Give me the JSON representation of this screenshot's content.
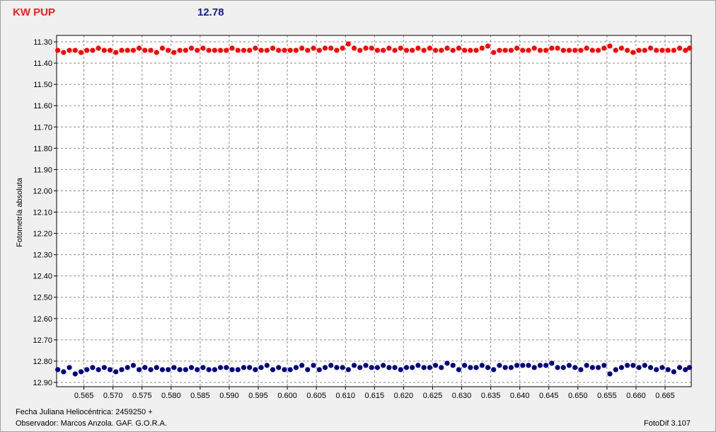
{
  "header": {
    "star_name": "KW PUP",
    "magnitude": "12.78"
  },
  "footer": {
    "fecha": "Fecha Juliana Heliocéntrica: 2459250 +",
    "observador": "Observador:  Marcos Anzola. GAF. G.O.R.A.",
    "software": "FotoDif 3.107"
  },
  "chart_data": {
    "type": "scatter",
    "ylabel": "Fotometría absoluta",
    "xlabel": "Fecha Juliana Heliocéntrica: 2459250 +",
    "xlim": [
      0.5603,
      0.6695
    ],
    "ylim": [
      12.92,
      11.27
    ],
    "y_inverted": true,
    "grid": true,
    "x_ticks": [
      "0.565",
      "0.570",
      "0.575",
      "0.580",
      "0.585",
      "0.590",
      "0.595",
      "0.600",
      "0.605",
      "0.610",
      "0.615",
      "0.620",
      "0.625",
      "0.630",
      "0.635",
      "0.640",
      "0.645",
      "0.650",
      "0.655",
      "0.660",
      "0.665"
    ],
    "y_ticks": [
      "11.30",
      "11.40",
      "11.50",
      "11.60",
      "11.70",
      "11.80",
      "11.90",
      "12.00",
      "12.10",
      "12.20",
      "12.30",
      "12.40",
      "12.50",
      "12.60",
      "12.70",
      "12.80",
      "12.90"
    ],
    "colors": {
      "series_top": "#ff0000",
      "series_bottom": "#000080"
    },
    "series": [
      {
        "x": [
          0.5605,
          0.5615,
          0.5625,
          0.5635,
          0.5645,
          0.5655,
          0.5665,
          0.5675,
          0.5685,
          0.5695,
          0.5705,
          0.5715,
          0.5725,
          0.5735,
          0.5745,
          0.5755,
          0.5765,
          0.5775,
          0.5785,
          0.5795,
          0.5805,
          0.5815,
          0.5825,
          0.5835,
          0.5845,
          0.5855,
          0.5865,
          0.5875,
          0.5885,
          0.5895,
          0.5905,
          0.5915,
          0.5925,
          0.5935,
          0.5945,
          0.5955,
          0.5965,
          0.5975,
          0.5985,
          0.5995,
          0.6005,
          0.6015,
          0.6025,
          0.6035,
          0.6045,
          0.6055,
          0.6065,
          0.6075,
          0.6085,
          0.6095,
          0.6105,
          0.6115,
          0.6125,
          0.6135,
          0.6145,
          0.6155,
          0.6165,
          0.6175,
          0.6185,
          0.6195,
          0.6205,
          0.6215,
          0.6225,
          0.6235,
          0.6245,
          0.6255,
          0.6265,
          0.6275,
          0.6285,
          0.6295,
          0.6305,
          0.6315,
          0.6325,
          0.6335,
          0.6345,
          0.6355,
          0.6365,
          0.6375,
          0.6385,
          0.6395,
          0.6405,
          0.6415,
          0.6425,
          0.6435,
          0.6445,
          0.6455,
          0.6465,
          0.6475,
          0.6485,
          0.6495,
          0.6505,
          0.6515,
          0.6525,
          0.6535,
          0.6545,
          0.6555,
          0.6565,
          0.6575,
          0.6585,
          0.6595,
          0.6605,
          0.6615,
          0.6625,
          0.6635,
          0.6645,
          0.6655,
          0.6665,
          0.6675,
          0.6685,
          0.6692
        ],
        "y": [
          11.34,
          11.35,
          11.34,
          11.34,
          11.35,
          11.34,
          11.34,
          11.33,
          11.34,
          11.34,
          11.35,
          11.34,
          11.34,
          11.34,
          11.33,
          11.34,
          11.34,
          11.35,
          11.33,
          11.34,
          11.35,
          11.34,
          11.34,
          11.33,
          11.34,
          11.33,
          11.34,
          11.34,
          11.34,
          11.34,
          11.33,
          11.34,
          11.34,
          11.34,
          11.33,
          11.34,
          11.34,
          11.33,
          11.34,
          11.34,
          11.34,
          11.34,
          11.33,
          11.34,
          11.33,
          11.34,
          11.33,
          11.33,
          11.34,
          11.33,
          11.31,
          11.33,
          11.34,
          11.33,
          11.33,
          11.34,
          11.34,
          11.33,
          11.34,
          11.33,
          11.34,
          11.34,
          11.33,
          11.34,
          11.33,
          11.34,
          11.34,
          11.33,
          11.34,
          11.33,
          11.34,
          11.34,
          11.34,
          11.33,
          11.32,
          11.35,
          11.34,
          11.34,
          11.34,
          11.33,
          11.34,
          11.34,
          11.33,
          11.34,
          11.34,
          11.33,
          11.33,
          11.34,
          11.34,
          11.34,
          11.34,
          11.33,
          11.34,
          11.34,
          11.33,
          11.32,
          11.34,
          11.33,
          11.34,
          11.35,
          11.34,
          11.34,
          11.33,
          11.34,
          11.34,
          11.34,
          11.34,
          11.33,
          11.34,
          11.33
        ]
      },
      {
        "x": [
          0.5605,
          0.5615,
          0.5625,
          0.5635,
          0.5645,
          0.5655,
          0.5665,
          0.5675,
          0.5685,
          0.5695,
          0.5705,
          0.5715,
          0.5725,
          0.5735,
          0.5745,
          0.5755,
          0.5765,
          0.5775,
          0.5785,
          0.5795,
          0.5805,
          0.5815,
          0.5825,
          0.5835,
          0.5845,
          0.5855,
          0.5865,
          0.5875,
          0.5885,
          0.5895,
          0.5905,
          0.5915,
          0.5925,
          0.5935,
          0.5945,
          0.5955,
          0.5965,
          0.5975,
          0.5985,
          0.5995,
          0.6005,
          0.6015,
          0.6025,
          0.6035,
          0.6045,
          0.6055,
          0.6065,
          0.6075,
          0.6085,
          0.6095,
          0.6105,
          0.6115,
          0.6125,
          0.6135,
          0.6145,
          0.6155,
          0.6165,
          0.6175,
          0.6185,
          0.6195,
          0.6205,
          0.6215,
          0.6225,
          0.6235,
          0.6245,
          0.6255,
          0.6265,
          0.6275,
          0.6285,
          0.6295,
          0.6305,
          0.6315,
          0.6325,
          0.6335,
          0.6345,
          0.6355,
          0.6365,
          0.6375,
          0.6385,
          0.6395,
          0.6405,
          0.6415,
          0.6425,
          0.6435,
          0.6445,
          0.6455,
          0.6465,
          0.6475,
          0.6485,
          0.6495,
          0.6505,
          0.6515,
          0.6525,
          0.6535,
          0.6545,
          0.6555,
          0.6565,
          0.6575,
          0.6585,
          0.6595,
          0.6605,
          0.6615,
          0.6625,
          0.6635,
          0.6645,
          0.6655,
          0.6665,
          0.6675,
          0.6685,
          0.6692
        ],
        "y": [
          12.84,
          12.85,
          12.83,
          12.86,
          12.85,
          12.84,
          12.83,
          12.84,
          12.83,
          12.84,
          12.85,
          12.84,
          12.83,
          12.82,
          12.84,
          12.83,
          12.84,
          12.83,
          12.84,
          12.84,
          12.83,
          12.84,
          12.84,
          12.83,
          12.84,
          12.83,
          12.84,
          12.84,
          12.83,
          12.83,
          12.84,
          12.84,
          12.83,
          12.83,
          12.84,
          12.83,
          12.82,
          12.84,
          12.83,
          12.84,
          12.84,
          12.83,
          12.82,
          12.84,
          12.82,
          12.84,
          12.83,
          12.82,
          12.83,
          12.83,
          12.84,
          12.82,
          12.83,
          12.82,
          12.83,
          12.83,
          12.82,
          12.83,
          12.83,
          12.84,
          12.83,
          12.83,
          12.82,
          12.83,
          12.83,
          12.82,
          12.83,
          12.81,
          12.82,
          12.84,
          12.82,
          12.83,
          12.83,
          12.82,
          12.83,
          12.84,
          12.82,
          12.83,
          12.83,
          12.82,
          12.82,
          12.82,
          12.83,
          12.82,
          12.82,
          12.81,
          12.83,
          12.83,
          12.82,
          12.83,
          12.84,
          12.82,
          12.83,
          12.83,
          12.82,
          12.86,
          12.84,
          12.83,
          12.82,
          12.82,
          12.83,
          12.82,
          12.83,
          12.84,
          12.83,
          12.84,
          12.85,
          12.83,
          12.84,
          12.83
        ]
      }
    ]
  }
}
